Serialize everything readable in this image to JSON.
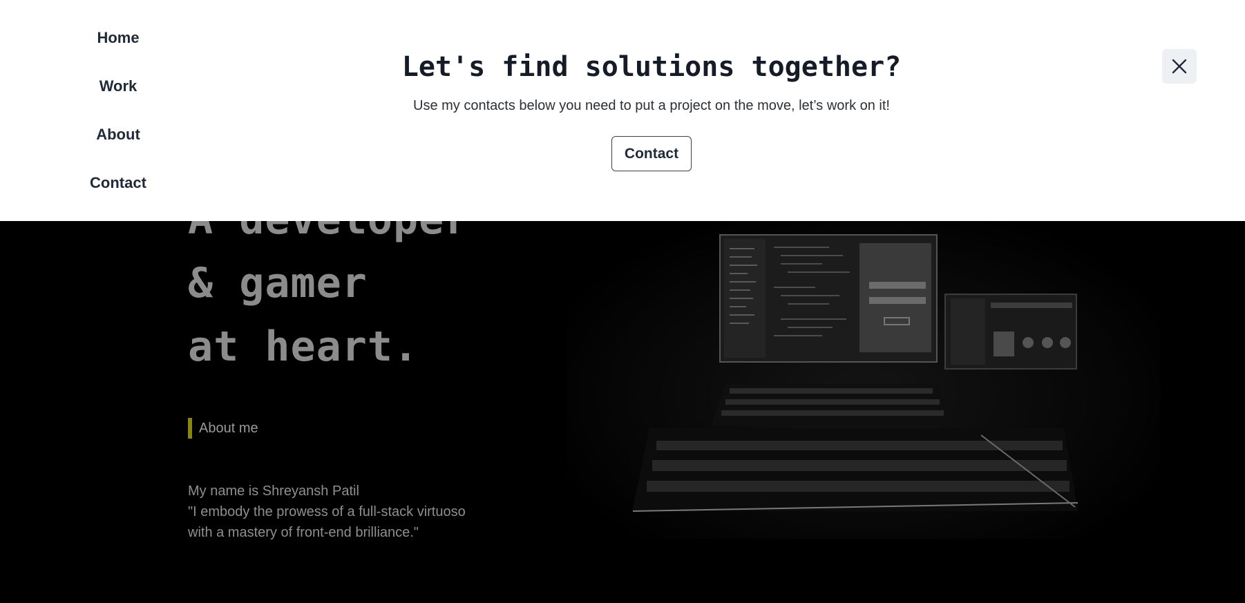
{
  "nav": {
    "items": [
      {
        "label": "Home"
      },
      {
        "label": "Work"
      },
      {
        "label": "About"
      },
      {
        "label": "Contact"
      }
    ]
  },
  "contact_panel": {
    "title": "Let's find solutions together?",
    "text": "Use my contacts below you need to put a project on the move, let’s work on it!",
    "button_label": "Contact",
    "close_icon": "close-icon"
  },
  "hero": {
    "headline": [
      "A developer",
      "& gamer",
      "at heart."
    ],
    "about_label": "About me",
    "bio": [
      "My name is Shreyansh Patil",
      "\"I embody the prowess of a full-stack virtuoso",
      "with a mastery of front-end brilliance.\""
    ],
    "image": "desk-setup-photo"
  },
  "colors": {
    "accent": "#8a8414",
    "text_dark": "#1f2937",
    "hero_text": "#8c8c8c"
  }
}
